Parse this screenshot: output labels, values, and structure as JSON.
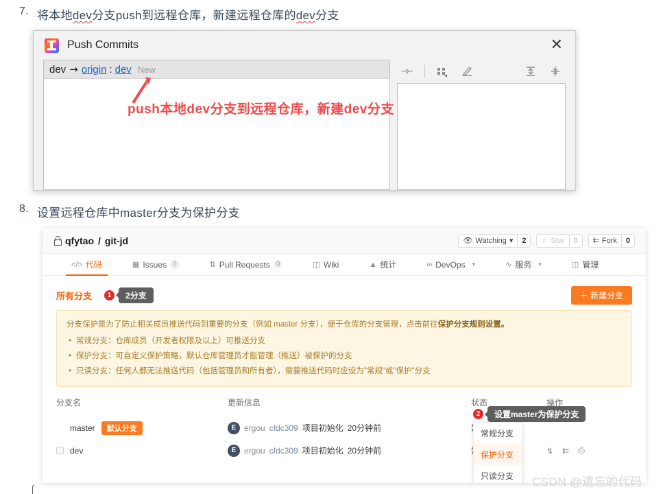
{
  "steps": [
    {
      "num": "7.",
      "pre": "将本地",
      "hl1": "dev",
      "mid": "分支push到远程仓库，新建远程仓库的",
      "hl2": "dev",
      "post": "分支"
    },
    {
      "num": "8.",
      "text": "设置远程仓库中master分支为保护分支"
    }
  ],
  "dialog": {
    "title": "Push Commits",
    "app_icon": "intellij-idea-icon",
    "close_label": "✕",
    "push_local": "dev",
    "arrow": "→",
    "remote": "origin",
    "separator": ":",
    "remote_branch": "dev",
    "new_label": "New",
    "toolbar_icons": [
      "collapse-arrows-icon",
      "grouping-icon",
      "edit-icon",
      "expand-all-icon",
      "collapse-all-icon"
    ]
  },
  "annotation": {
    "text": "push本地dev分支到远程仓库，新建dev分支",
    "color": "#f24a4a"
  },
  "gitee": {
    "repo": {
      "owner": "qfytao",
      "sep": "/",
      "name": "git-jd",
      "visibility_icon": "lock-icon"
    },
    "actions": [
      {
        "icon": "eye-icon",
        "label": "Watching",
        "caret": "▾",
        "count": "2",
        "dim": false
      },
      {
        "icon": "star-icon",
        "label": "Star",
        "caret": "",
        "count": "0",
        "dim": true
      },
      {
        "icon": "fork-icon",
        "label": "Fork",
        "caret": "",
        "count": "0",
        "dim": false
      }
    ],
    "nav": [
      {
        "icon": "code-icon",
        "label": "代码",
        "badge": "",
        "caret": "",
        "active": true
      },
      {
        "icon": "issue-icon",
        "label": "Issues",
        "badge": "0",
        "caret": "",
        "active": false
      },
      {
        "icon": "pr-icon",
        "label": "Pull Requests",
        "badge": "0",
        "caret": "",
        "active": false
      },
      {
        "icon": "wiki-icon",
        "label": "Wiki",
        "badge": "",
        "caret": "",
        "active": false
      },
      {
        "icon": "stats-icon",
        "label": "统计",
        "badge": "",
        "caret": "",
        "active": false
      },
      {
        "icon": "devops-icon",
        "label": "DevOps",
        "badge": "",
        "caret": "▾",
        "active": false
      },
      {
        "icon": "service-icon",
        "label": "服务",
        "badge": "",
        "caret": "▾",
        "active": false
      },
      {
        "icon": "manage-icon",
        "label": "管理",
        "badge": "",
        "caret": "",
        "active": false
      }
    ],
    "branch_header": {
      "title": "所有分支",
      "marker": "1",
      "tooltip": "2分支",
      "new_branch": "＋ 新建分支"
    },
    "notice": {
      "lead_a": "分支保护是为了防止相关成员推送代码到重要的分支（例如 master 分支），便于仓库的分支管理，点击前往",
      "lead_b": "保护分支规则设置。",
      "bullets": [
        "常规分支：仓库成员（开发者权限及以上）可推送分支",
        "保护分支：可自定义保护策略，默认仓库管理员才能管理（推送）被保护的分支",
        "只读分支：任何人都无法推送代码（包括管理员和所有者），需要推送代码时应设为\"常规\"或\"保护\"分支"
      ]
    },
    "table": {
      "headers": [
        "分支名",
        "更新信息",
        "状态",
        "操作"
      ],
      "rows": [
        {
          "name": "master",
          "badge": "默认分支",
          "avatar": "E",
          "author": "ergou",
          "sha": "cfdc309",
          "message": "项目初始化",
          "time": "20分钟前",
          "status": "常规分支",
          "caret": "▾",
          "actions": ""
        },
        {
          "name": "dev",
          "badge": "",
          "avatar": "E",
          "author": "ergou",
          "sha": "cfdc309",
          "message": "项目初始化",
          "time": "20分钟前",
          "status": "常规分支",
          "caret": "",
          "actions": "download-icon branch-icon trash-icon"
        }
      ]
    },
    "status_dropdown": {
      "options": [
        "常规分支",
        "保护分支",
        "只读分支"
      ],
      "selected": "保护分支"
    },
    "row_tooltip": {
      "marker": "2",
      "text": "设置master为保护分支"
    }
  },
  "watermark": "CSDN @遗忘的代码"
}
